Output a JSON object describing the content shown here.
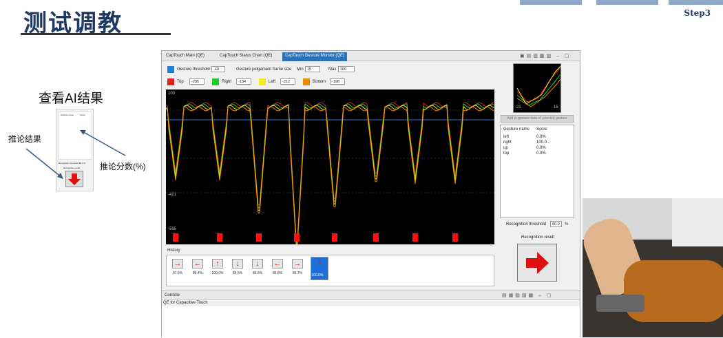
{
  "slide": {
    "title": "测试调教",
    "step": "Step3",
    "subtitle": "查看AI结果",
    "annotation_left": "推论结果",
    "annotation_right": "推论分数(%)"
  },
  "app": {
    "tabs": [
      "CapTouch Main (QE)",
      "CapTouch Status Chart (QE)",
      "CapTouch Gesture Monitor (QE)"
    ],
    "gesture_threshold_label": "Gesture threshold",
    "gesture_threshold_value": "-40",
    "frame_size_label": "Gesture judgement frame size",
    "min_label": "Min",
    "min_value": "15",
    "max_label": "Max",
    "max_value": "100",
    "channels": [
      {
        "label": "Top",
        "value": "-235",
        "color": "#e02020"
      },
      {
        "label": "Right",
        "value": "-134",
        "color": "#22cc22"
      },
      {
        "label": "Left",
        "value": "-212",
        "color": "#eeee22"
      },
      {
        "label": "Bottom",
        "value": "-198",
        "color": "#ee8800"
      }
    ],
    "plot_ticks": [
      "103",
      "-421",
      "-595"
    ],
    "history_label": "History",
    "history": [
      {
        "value": "97.6%",
        "dir": "right"
      },
      {
        "value": "86.4%",
        "dir": "left"
      },
      {
        "value": "100.0%",
        "dir": "up"
      },
      {
        "value": "85.5%",
        "dir": "down"
      },
      {
        "value": "85.5%",
        "dir": "down"
      },
      {
        "value": "86.8%",
        "dir": "left"
      },
      {
        "value": "86.7%",
        "dir": "right"
      },
      {
        "value": "100.0%",
        "dir": "down"
      }
    ],
    "mini_ticks": [
      "-21",
      "15"
    ],
    "add_button": "Add to gesture data of selected gesture",
    "score_headers": [
      "Gesture name",
      "Score"
    ],
    "scores": [
      {
        "name": "left",
        "score": "0.0%"
      },
      {
        "name": "right",
        "score": "100.0..."
      },
      {
        "name": "up",
        "score": "0.0%"
      },
      {
        "name": "top",
        "score": "0.0%"
      }
    ],
    "recognition_threshold_label": "Recognition threshold",
    "recognition_threshold_value": "80.0",
    "recognition_threshold_unit": "%",
    "recognition_result_label": "Recognition result",
    "console_tab": "Console",
    "console_line": "QE for Capacitive Touch"
  },
  "thumb": {
    "header": [
      "Gesture name",
      "Score"
    ],
    "threshold": "Recognition threshold 80.0 %",
    "result": "Recognition result"
  }
}
